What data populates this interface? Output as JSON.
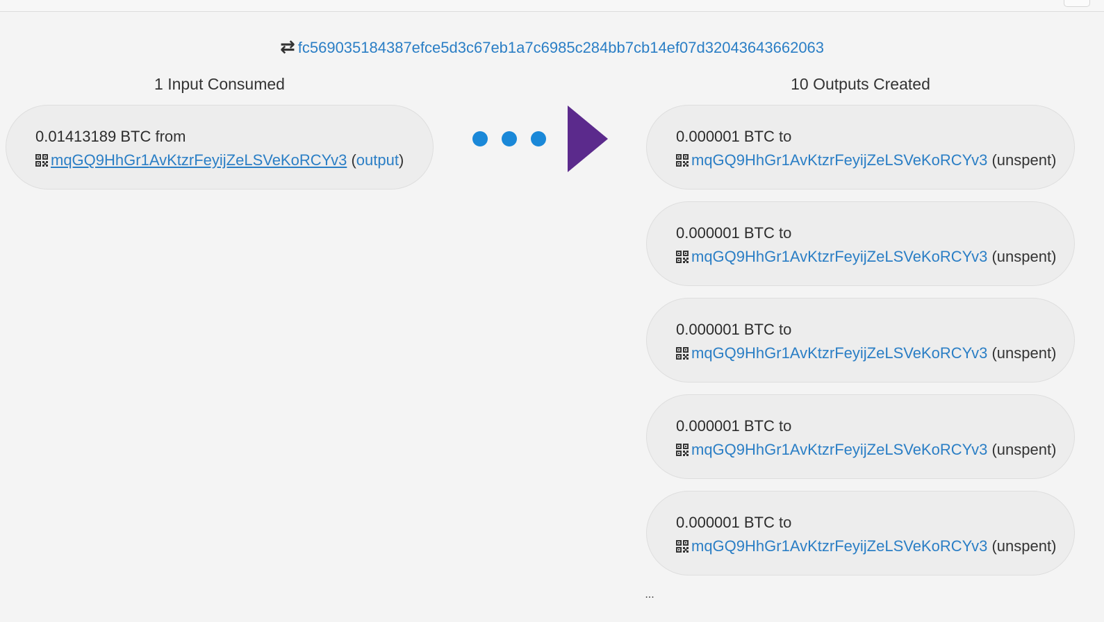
{
  "transaction": {
    "txid": "fc569035184387efce5d3c67eb1a7c6985c284bb7cb14ef07d32043643662063",
    "icon": "swap-arrows-icon"
  },
  "inputs": {
    "heading": "1 Input Consumed",
    "items": [
      {
        "amount": "0.01413189 BTC",
        "connector": "from",
        "address": "mqGQ9HhGr1AvKtzrFeyijZeLSVeKoRCYv3",
        "status_open": "(",
        "status": "output",
        "status_close": ")"
      }
    ]
  },
  "outputs": {
    "heading": "10 Outputs Created",
    "items": [
      {
        "amount": "0.000001 BTC",
        "connector": "to",
        "address": "mqGQ9HhGr1AvKtzrFeyijZeLSVeKoRCYv3",
        "status": "(unspent)"
      },
      {
        "amount": "0.000001 BTC",
        "connector": "to",
        "address": "mqGQ9HhGr1AvKtzrFeyijZeLSVeKoRCYv3",
        "status": "(unspent)"
      },
      {
        "amount": "0.000001 BTC",
        "connector": "to",
        "address": "mqGQ9HhGr1AvKtzrFeyijZeLSVeKoRCYv3",
        "status": "(unspent)"
      },
      {
        "amount": "0.000001 BTC",
        "connector": "to",
        "address": "mqGQ9HhGr1AvKtzrFeyijZeLSVeKoRCYv3",
        "status": "(unspent)"
      },
      {
        "amount": "0.000001 BTC",
        "connector": "to",
        "address": "mqGQ9HhGr1AvKtzrFeyijZeLSVeKoRCYv3",
        "status": "(unspent)"
      }
    ],
    "more": "..."
  },
  "colors": {
    "link": "#2a7ec5",
    "dots": "#1a88d8",
    "arrow": "#5b2a8c",
    "box_bg": "#ededed",
    "page_bg": "#f4f4f4"
  }
}
